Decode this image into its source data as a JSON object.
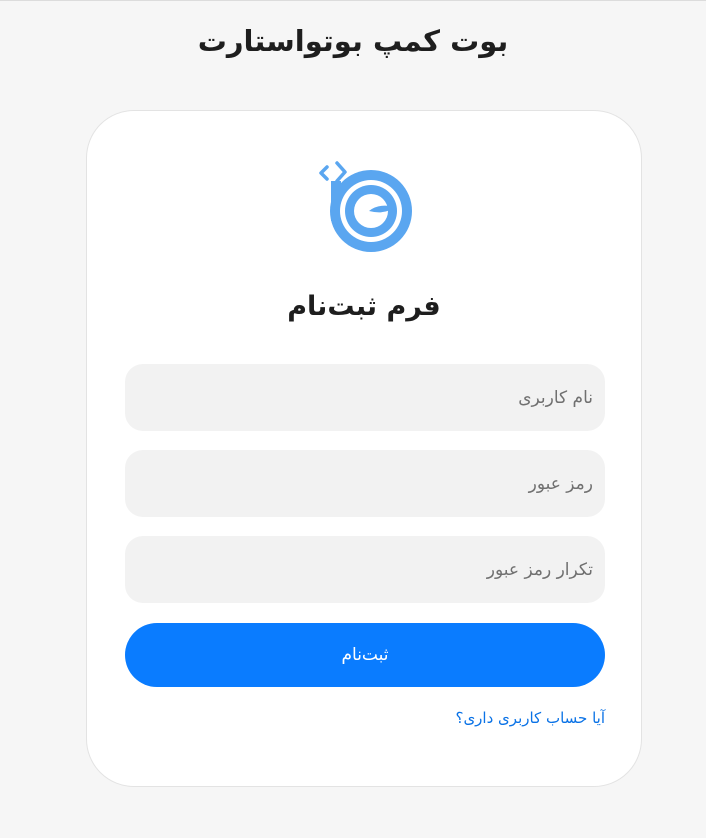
{
  "header": {
    "site_title": "بوت کمپ بوتواستارت"
  },
  "logo": {
    "icon": "bootostart-logo-icon",
    "color": "#5aa6f0"
  },
  "form": {
    "title": "فرم ثبت‌نام",
    "username_placeholder": "نام کاربری",
    "password_placeholder": "رمز عبور",
    "confirm_password_placeholder": "تکرار رمز عبور",
    "submit_label": "ثبت‌نام",
    "login_link": "آیا حساب کاربری داری؟"
  },
  "colors": {
    "accent": "#0a7cff",
    "link": "#0a72e6",
    "field_bg": "#f2f2f2",
    "page_bg": "#f6f6f6"
  }
}
